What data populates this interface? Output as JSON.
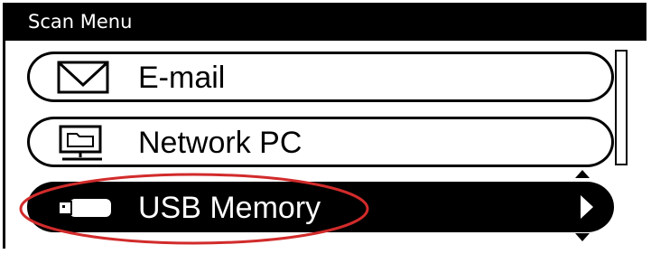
{
  "window": {
    "title": "Scan Menu"
  },
  "menu": {
    "items": [
      {
        "label": "E-mail",
        "icon": "envelope-icon",
        "selected": false
      },
      {
        "label": "Network PC",
        "icon": "network-pc-icon",
        "selected": false
      },
      {
        "label": "USB Memory",
        "icon": "usb-memory-icon",
        "selected": true
      }
    ]
  },
  "colors": {
    "background": "#ffffff",
    "foreground": "#000000",
    "highlight": "#d22b2b"
  }
}
